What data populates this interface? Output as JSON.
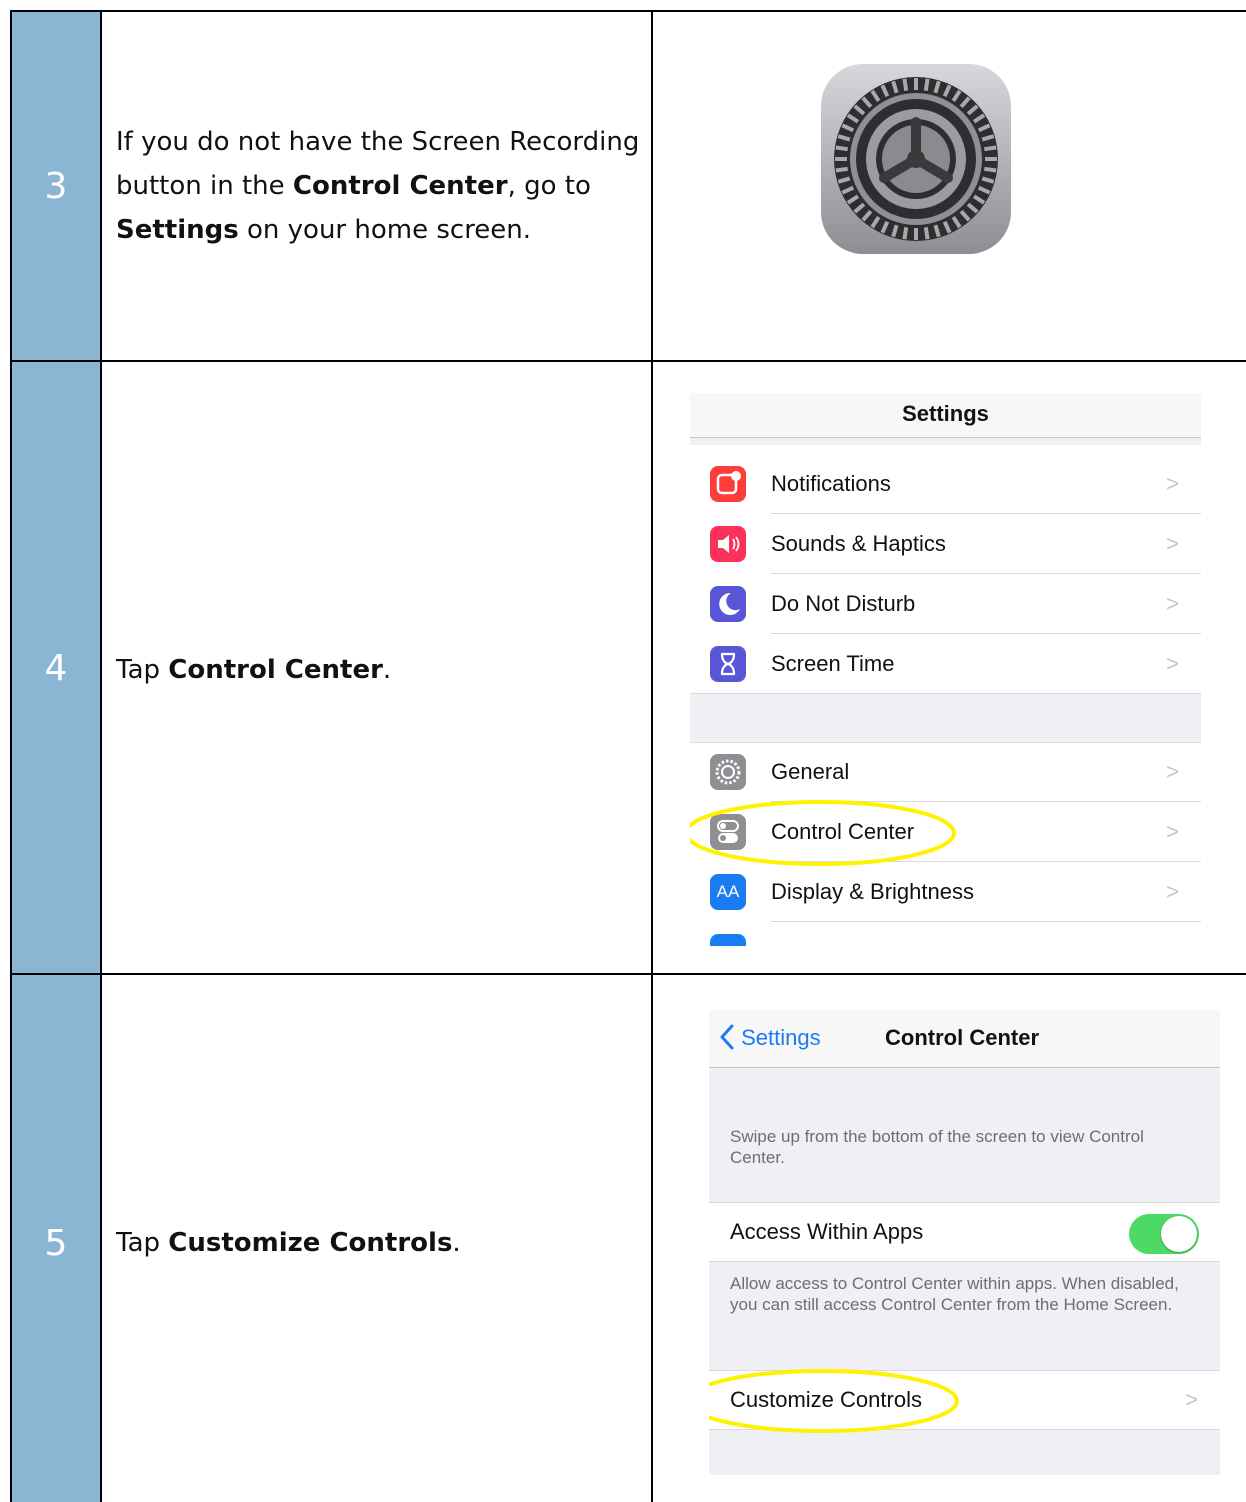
{
  "steps": [
    {
      "number": "3",
      "parts": [
        "If you do not have the Screen Recording button in the ",
        "Control Center",
        ", go to ",
        "Settings",
        " on your home screen."
      ]
    },
    {
      "number": "4",
      "parts": [
        "Tap ",
        "Control Center",
        "."
      ]
    },
    {
      "number": "5",
      "parts": [
        "Tap ",
        "Customize Controls",
        "."
      ]
    }
  ],
  "settings_screen": {
    "title": "Settings",
    "group1": [
      {
        "label": "Notifications",
        "icon": "notifications-icon",
        "color": "#fc3d39"
      },
      {
        "label": "Sounds & Haptics",
        "icon": "sounds-icon",
        "color": "#fc3158"
      },
      {
        "label": "Do Not Disturb",
        "icon": "moon-icon",
        "color": "#5856d6"
      },
      {
        "label": "Screen Time",
        "icon": "hourglass-icon",
        "color": "#5856d6"
      }
    ],
    "group2": [
      {
        "label": "General",
        "icon": "gear-icon",
        "color": "#8e8e93"
      },
      {
        "label": "Control Center",
        "icon": "control-center-icon",
        "color": "#8e8e93"
      },
      {
        "label": "Display & Brightness",
        "icon": "display-icon",
        "color": "#1a7cf5",
        "glyph": "AA"
      }
    ],
    "chevron": ">"
  },
  "control_center_screen": {
    "back_label": "Settings",
    "title": "Control Center",
    "intro_footer": "Swipe up from the bottom of the screen to view Control Center.",
    "access_label": "Access Within Apps",
    "access_enabled": true,
    "access_footer": "Allow access to Control Center within apps. When disabled, you can still access Control Center from the Home Screen.",
    "customize_label": "Customize Controls",
    "chevron": ">"
  },
  "colors": {
    "number_column": "#8ab6d3",
    "highlight": "#fff200",
    "ios_blue": "#1a7cf5",
    "toggle_on": "#4cd964"
  }
}
